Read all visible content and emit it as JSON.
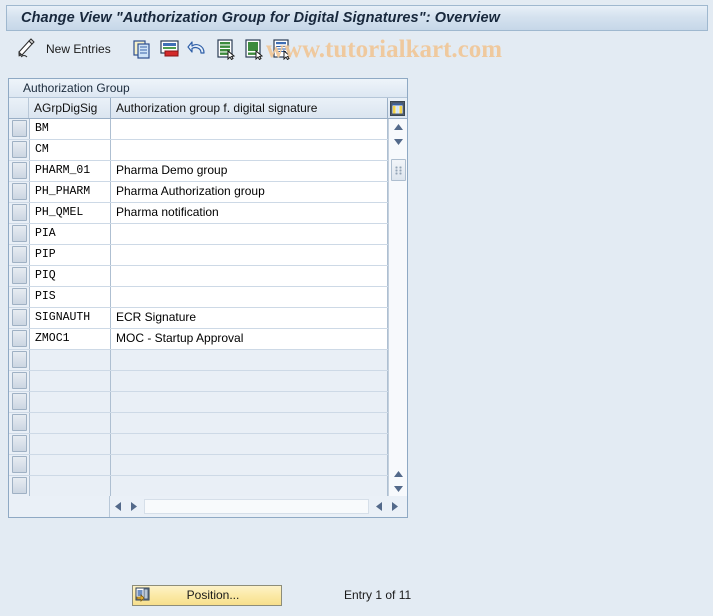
{
  "window": {
    "title": "Change View \"Authorization Group for Digital Signatures\": Overview"
  },
  "toolbar": {
    "change_icon": "pencil-paper-icon",
    "new_entries_label": "New Entries",
    "buttons": [
      {
        "name": "copy-as-icon",
        "tooltip": "Copy As..."
      },
      {
        "name": "delete-icon",
        "tooltip": "Delete"
      },
      {
        "name": "undo-icon",
        "tooltip": "Undo Change"
      },
      {
        "name": "select-all-icon",
        "tooltip": "Select All"
      },
      {
        "name": "deselect-all-icon",
        "tooltip": "Deselect All"
      },
      {
        "name": "details-icon",
        "tooltip": "Details"
      }
    ]
  },
  "watermark": {
    "text": "www.tutorialkart.com",
    "color": "#f0c89a"
  },
  "panel": {
    "title": "Authorization Group",
    "columns": {
      "key": "AGrpDigSig",
      "description": "Authorization group f. digital signature",
      "config_icon": "table-settings-icon"
    },
    "rows": [
      {
        "key": "BM",
        "description": ""
      },
      {
        "key": "CM",
        "description": ""
      },
      {
        "key": "PHARM_01",
        "description": "Pharma Demo group"
      },
      {
        "key": "PH_PHARM",
        "description": "Pharma Authorization group"
      },
      {
        "key": "PH_QMEL",
        "description": "Pharma notification"
      },
      {
        "key": "PIA",
        "description": ""
      },
      {
        "key": "PIP",
        "description": ""
      },
      {
        "key": "PIQ",
        "description": ""
      },
      {
        "key": "PIS",
        "description": ""
      },
      {
        "key": "SIGNAUTH",
        "description": "ECR Signature"
      },
      {
        "key": "ZMOC1",
        "description": "MOC - Startup Approval"
      }
    ],
    "empty_row_count": 7,
    "vertical_scrollbar": {
      "up_icon": "scroll-up-icon",
      "down_icon": "scroll-down-icon",
      "thumb": "scroll-thumb",
      "page_up_icon": "page-up-icon",
      "page_down_icon": "page-down-icon"
    },
    "horizontal_scrollbar": {
      "left_icon": "scroll-left-icon",
      "right_icon": "scroll-right-icon",
      "page_left_icon": "page-left-icon",
      "page_right_icon": "page-right-icon"
    }
  },
  "footer": {
    "position_button": {
      "label": "Position...",
      "icon": "position-icon"
    },
    "entry_status": "Entry 1 of 11"
  },
  "colors": {
    "background": "#e3ebf3",
    "panel_border": "#8fa9c4",
    "title_text": "#18283c",
    "button_yellow": "#fbe9a6"
  }
}
